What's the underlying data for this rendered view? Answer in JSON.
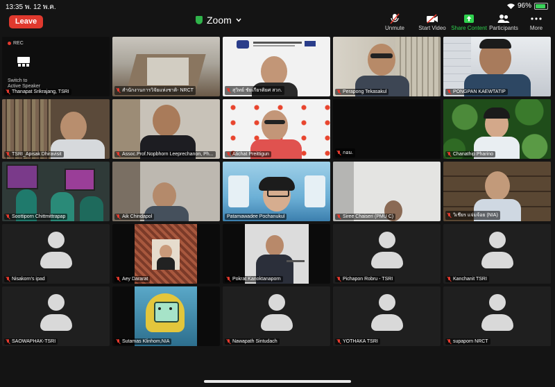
{
  "status_bar": {
    "time": "13:35",
    "date": "พ. 12 พ.ค.",
    "battery": "96%"
  },
  "toolbar": {
    "leave_label": "Leave",
    "title": "Zoom",
    "unmute_label": "Unmute",
    "start_video_label": "Start Video",
    "share_content_label": "Share Content",
    "participants_label": "Participants",
    "more_label": "More"
  },
  "self_view": {
    "rec_label": "REC",
    "switch_label_1": "Switch to",
    "switch_label_2": "Active Speaker"
  },
  "colors": {
    "leave": "#e0392e",
    "share": "#2fd14e",
    "active_speaker": "#3fd34d",
    "muted": "#e53a2e"
  },
  "participants": [
    {
      "name": "Thanapat Srikrajang, TSRI"
    },
    {
      "name": "สำนักงานการวิจัยแห่งชาติ- NRCT"
    },
    {
      "name": "สุวิทย์ ชัยเกียรติยศ สวก."
    },
    {
      "name": "Perapong Tekasakul"
    },
    {
      "name": "PONGPAN KAEWTATIP"
    },
    {
      "name": "TSRI_Apisak Dhiravisit"
    },
    {
      "name": "Assoc.Prof.Nopbhorn Leeprechanon, Ph..."
    },
    {
      "name": "Atichat Preittigun"
    },
    {
      "name": "กอม."
    },
    {
      "name": "Chanathip Pharino"
    },
    {
      "name": "Soottiporn Chittmittrapap"
    },
    {
      "name": "Aik Chindapol"
    },
    {
      "name": "Patamawadee Pochanukul"
    },
    {
      "name": "Siree Chaiseri (PMU C)"
    },
    {
      "name": "วิเชียร แจ่มจ้อย (NIA)"
    },
    {
      "name": "Nisakorn's ipad"
    },
    {
      "name": "Aey Dararat"
    },
    {
      "name": "Pokrat Kanoktanaporn"
    },
    {
      "name": "Pichapon Robru - TSRI"
    },
    {
      "name": "Kanchanit TSRI"
    },
    {
      "name": "SAOWAPHAK-TSRI"
    },
    {
      "name": "Sutamas Klinhom,NIA"
    },
    {
      "name": "Nawapath Sintudach"
    },
    {
      "name": "YOTHAKA TSRI"
    },
    {
      "name": "supaporn NRCT"
    }
  ]
}
